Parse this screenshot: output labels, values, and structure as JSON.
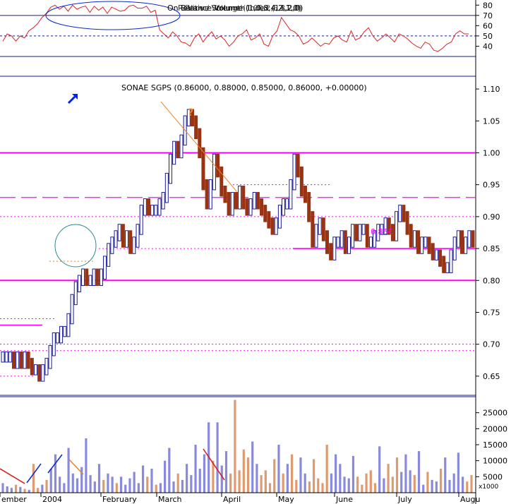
{
  "colors": {
    "background": "#ffffff",
    "axis_line": "#1a1a8c",
    "magenta": "#ff00ff",
    "rsi_line": "#dd2222",
    "up_bar": "#1a1a9a",
    "down_bar": "#993311",
    "volume_up": "#8a8add",
    "volume_down": "#e09a70",
    "annotation_orange": "#f08020",
    "annotation_red": "#dd1111",
    "annotation_blue": "#0a2ad0",
    "circle": "#2a8a8a",
    "arrow": "#0022ee"
  },
  "rsi_panel": {
    "title": "On Balance Volume (1,0,8,4,2,1,0)",
    "overlay_title_2": "Relative Strength Index (14,2,0)",
    "overlay_title_3": "Price / Volume (1.00,2,5,3,2,0)",
    "ticks": [
      "80",
      "70",
      "60",
      "50",
      "40"
    ],
    "overbought": 70,
    "oversold": 30,
    "midline": 50
  },
  "price_panel": {
    "title": "SONAE SGPS (0.86000, 0.88000, 0.85000, 0.86000, +0.00000)",
    "ticks": [
      "1.10",
      "1.05",
      "1.00",
      "0.95",
      "0.90",
      "0.85",
      "0.80",
      "0.75",
      "0.70",
      "0.65"
    ],
    "question_mark": "?",
    "support_label": "0,85€",
    "arrow_icon": "north-east-arrow"
  },
  "volume_panel": {
    "ticks": [
      "25000",
      "20000",
      "15000",
      "10000",
      "5000"
    ],
    "unit": "x1000"
  },
  "x_axis": {
    "labels": [
      "ember",
      "2004",
      "February",
      "March",
      "April",
      "May",
      "June",
      "July",
      "Augu"
    ]
  },
  "chart_data": {
    "type": "bar",
    "title": "SONAE SGPS (0.86000, 0.88000, 0.85000, 0.86000, +0.00000)",
    "ylim_price": [
      0.62,
      1.12
    ],
    "ylim_rsi": [
      30,
      85
    ],
    "ylim_volume": [
      0,
      30000
    ],
    "horizontal_levels": [
      1.0,
      0.93,
      0.9,
      0.85,
      0.8
    ],
    "price_close": [
      0.68,
      0.68,
      0.68,
      0.67,
      0.68,
      0.67,
      0.68,
      0.67,
      0.66,
      0.66,
      0.65,
      0.66,
      0.67,
      0.69,
      0.71,
      0.71,
      0.72,
      0.72,
      0.74,
      0.77,
      0.79,
      0.8,
      0.81,
      0.8,
      0.8,
      0.81,
      0.8,
      0.81,
      0.83,
      0.85,
      0.86,
      0.87,
      0.88,
      0.86,
      0.87,
      0.85,
      0.86,
      0.88,
      0.91,
      0.92,
      0.91,
      0.91,
      0.91,
      0.92,
      0.93,
      0.96,
      0.99,
      1.01,
      1.0,
      1.02,
      1.05,
      1.06,
      1.05,
      1.03,
      1.0,
      0.95,
      0.92,
      0.95,
      0.99,
      0.97,
      0.94,
      0.93,
      0.91,
      0.93,
      0.92,
      0.94,
      0.92,
      0.91,
      0.92,
      0.93,
      0.92,
      0.91,
      0.9,
      0.89,
      0.88,
      0.89,
      0.91,
      0.92,
      0.92,
      0.95,
      0.99,
      0.97,
      0.94,
      0.93,
      0.9,
      0.86,
      0.88,
      0.89,
      0.87,
      0.85,
      0.84,
      0.86,
      0.86,
      0.87,
      0.85,
      0.86,
      0.88,
      0.87,
      0.88,
      0.88,
      0.86,
      0.86,
      0.87,
      0.88,
      0.88,
      0.89,
      0.88,
      0.87,
      0.9,
      0.91,
      0.9,
      0.88,
      0.86,
      0.87,
      0.85,
      0.86,
      0.86,
      0.85,
      0.84,
      0.84,
      0.83,
      0.82,
      0.82,
      0.84,
      0.86,
      0.87,
      0.85,
      0.86,
      0.87,
      0.86
    ],
    "rsi": [
      45,
      52,
      50,
      45,
      50,
      48,
      55,
      58,
      62,
      68,
      72,
      78,
      80,
      76,
      79,
      74,
      80,
      76,
      78,
      79,
      73,
      79,
      75,
      78,
      72,
      78,
      76,
      74,
      75,
      79,
      80,
      77,
      77,
      79,
      73,
      75,
      56,
      52,
      48,
      54,
      50,
      44,
      43,
      40,
      48,
      52,
      44,
      50,
      54,
      47,
      50,
      46,
      40,
      44,
      50,
      52,
      56,
      46,
      48,
      52,
      42,
      40,
      50,
      55,
      68,
      62,
      56,
      54,
      50,
      42,
      44,
      48,
      44,
      40,
      43,
      42,
      48,
      50,
      46,
      44,
      55,
      46,
      48,
      54,
      58,
      50,
      45,
      48,
      52,
      48,
      44,
      52,
      50,
      47,
      43,
      40,
      38,
      44,
      42,
      36,
      35,
      38,
      42,
      44,
      52,
      55,
      52,
      52
    ],
    "volume": [
      3000,
      2000,
      1500,
      2500,
      1800,
      1200,
      900,
      9000,
      1500,
      2500,
      4000,
      7500,
      12000,
      5000,
      3000,
      14000,
      6000,
      4500,
      8000,
      17000,
      5500,
      3500,
      9000,
      4000,
      6000,
      5000,
      3000,
      5000,
      2500,
      4500,
      6500,
      3000,
      8500,
      5000,
      7500,
      2500,
      3000,
      10000,
      14000,
      3500,
      6000,
      4000,
      9000,
      5500,
      15000,
      7500,
      12000,
      22000,
      10000,
      22000,
      8500,
      13000,
      6000,
      29000,
      7000,
      13500,
      11000,
      16000,
      9000,
      5500,
      7000,
      3000,
      10500,
      15000,
      6000,
      9000,
      12000,
      4000,
      11000,
      6000,
      3500,
      10500,
      4500,
      3000,
      15000,
      6000,
      12000,
      9000,
      5000,
      4500,
      11500,
      5000,
      2500,
      6000,
      7000,
      3000,
      14500,
      4500,
      9000,
      5000,
      11000,
      6500,
      12000,
      7000,
      5500,
      13000,
      2500,
      6500,
      4000,
      3500,
      7500,
      11000,
      4000,
      6000,
      12500,
      5000,
      3500,
      5500
    ]
  }
}
